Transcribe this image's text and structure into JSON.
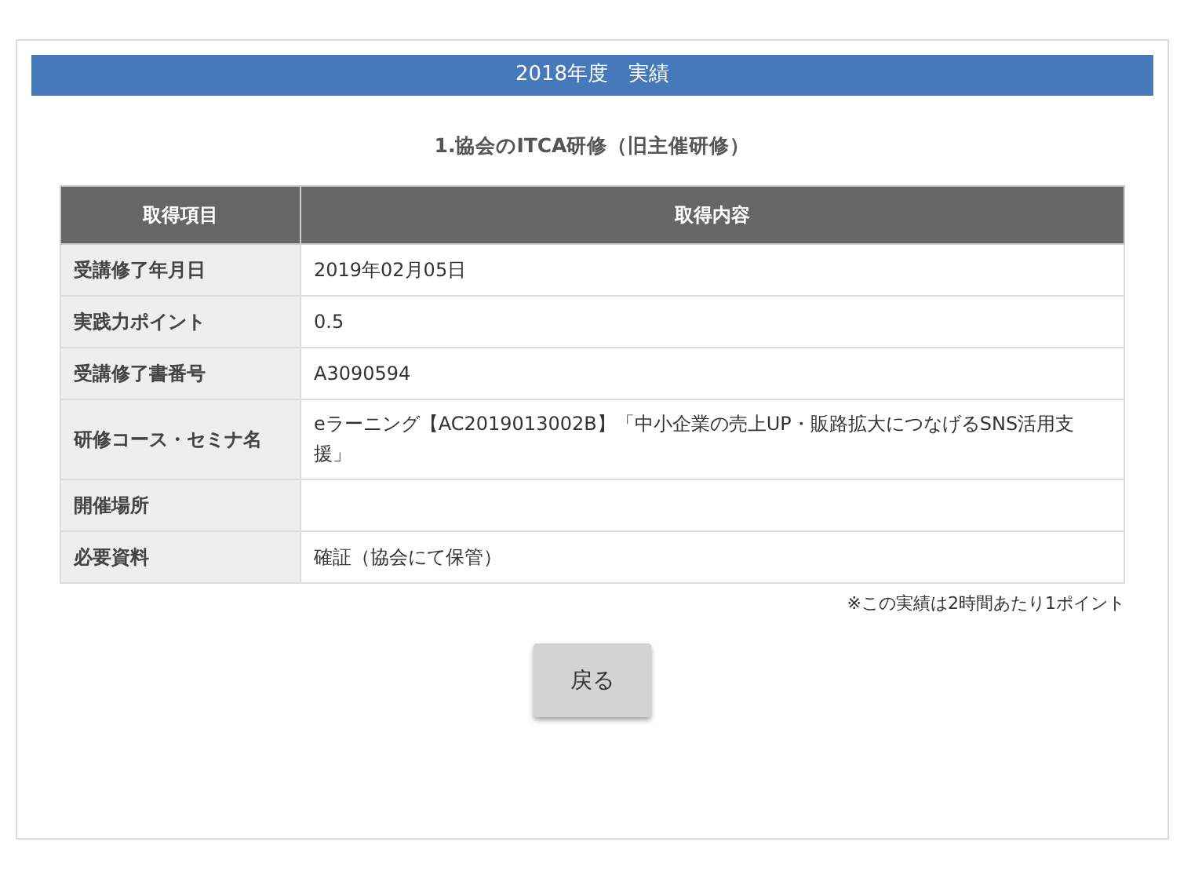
{
  "header": {
    "title": "2018年度　実績"
  },
  "section_title": "1.協会のITCA研修（旧主催研修）",
  "table": {
    "columns": [
      "取得項目",
      "取得内容"
    ],
    "rows": [
      {
        "label": "受講修了年月日",
        "value": "2019年02月05日"
      },
      {
        "label": "実践力ポイント",
        "value": "0.5"
      },
      {
        "label": "受講修了書番号",
        "value": "A3090594"
      },
      {
        "label": "研修コース・セミナ名",
        "value": "eラーニング【AC2019013002B】「中小企業の売上UP・販路拡大につなげるSNS活用支援」"
      },
      {
        "label": "開催場所"
      },
      {
        "label": "必要資料",
        "value": "確証（協会にて保管）"
      }
    ]
  },
  "note": "※この実績は2時間あたり1ポイント",
  "back_button": "戻る"
}
